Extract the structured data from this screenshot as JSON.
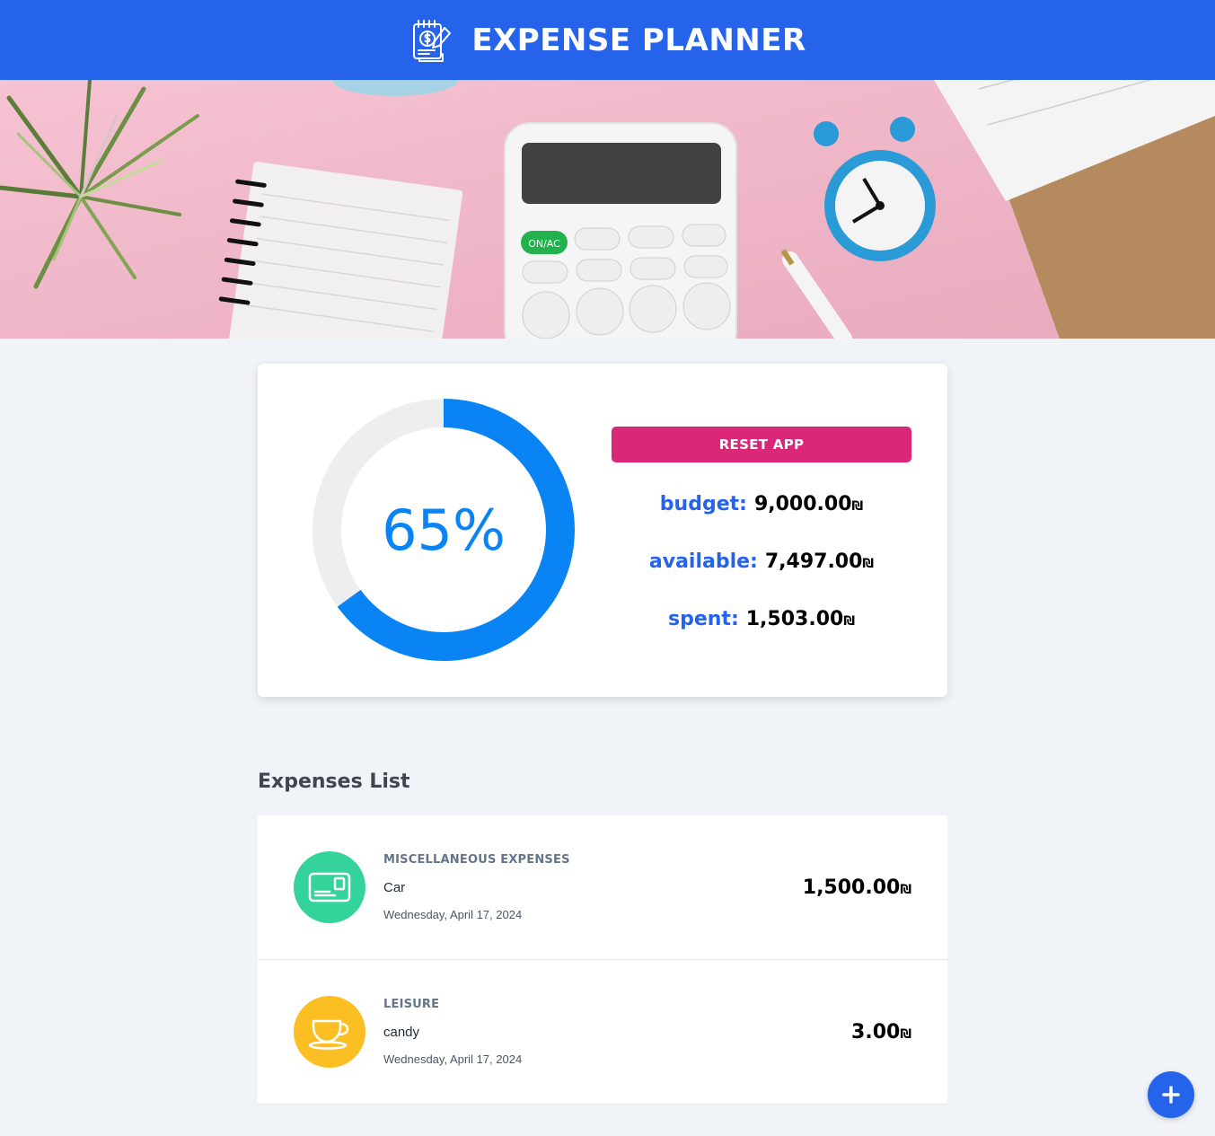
{
  "header": {
    "title": "EXPENSE PLANNER",
    "logo_icon": "expense-notepad-icon"
  },
  "hero": {
    "image": "desk-with-calculator-clock-notebook"
  },
  "summary": {
    "progress_percent": 65,
    "progress_label": "65%",
    "reset_label": "RESET APP",
    "budget_label": "budget:",
    "budget_value": "9,000.00",
    "available_label": "available:",
    "available_value": "7,497.00",
    "spent_label": "spent:",
    "spent_value": "1,503.00",
    "currency": "₪"
  },
  "colors": {
    "primary": "#2563eb",
    "progress": "#0a84f5",
    "reset": "#db2777",
    "misc": "#34d399",
    "leisure": "#fbbf24"
  },
  "expenses_heading": "Expenses List",
  "expenses": [
    {
      "category": "MISCELLANEOUS EXPENSES",
      "name": "Car",
      "date": "Wednesday, April 17, 2024",
      "amount": "1,500.00",
      "icon": "miscellaneous-card-icon"
    },
    {
      "category": "LEISURE",
      "name": "candy",
      "date": "Wednesday, April 17, 2024",
      "amount": "3.00",
      "icon": "leisure-cup-icon"
    }
  ],
  "fab": {
    "icon": "plus-icon"
  }
}
